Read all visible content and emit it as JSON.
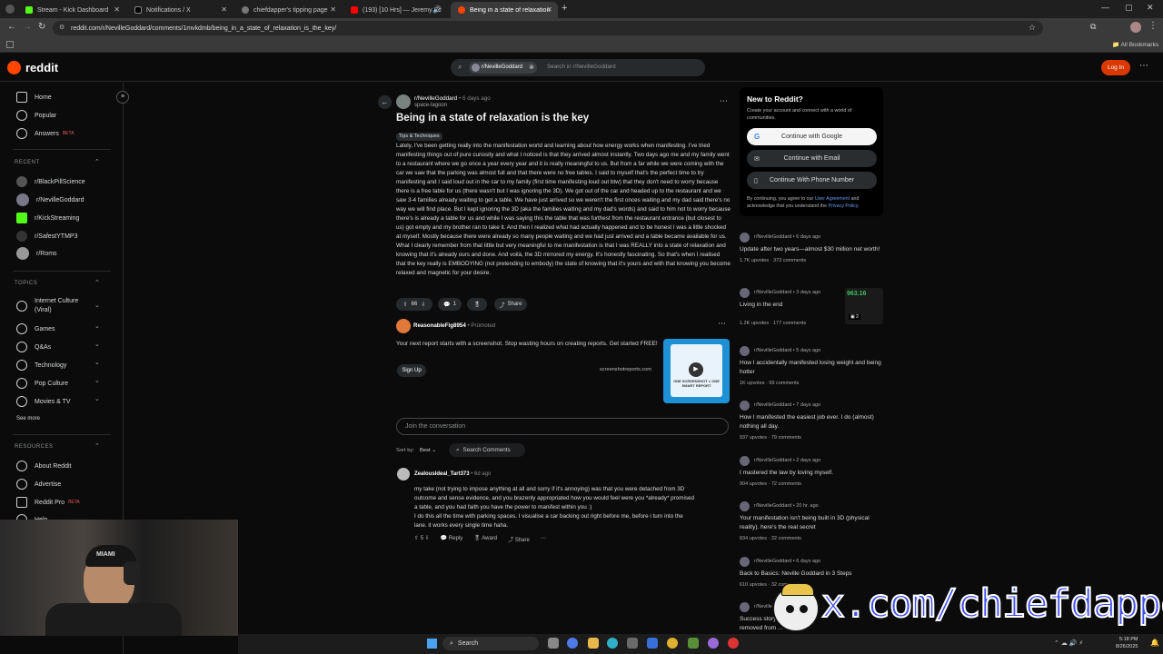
{
  "browser": {
    "tabs": [
      {
        "title": "Stream - Kick Dashboard",
        "fav": "#53fc18"
      },
      {
        "title": "Notifications / X",
        "fav": "#000000"
      },
      {
        "title": "chiefdapper's tipping page",
        "fav": "#777777"
      },
      {
        "title": "(193) [10 Hrs] — Jeremy Sc",
        "fav": "#ff0000"
      },
      {
        "title": "Being in a state of relaxation is",
        "fav": "#ff4500"
      }
    ],
    "url": "reddit.com/r/NevilleGoddard/comments/1mvkdmb/being_in_a_state_of_relaxation_is_the_key/",
    "all_bookmarks": "All Bookmarks"
  },
  "header": {
    "logo": "reddit",
    "search_chip": "r/NevilleGoddard",
    "search_placeholder": "Search in r/NevilleGoddard",
    "login": "Log In"
  },
  "sidebar": {
    "main": [
      "Home",
      "Popular",
      "Answers"
    ],
    "beta": "BETA",
    "recent_label": "RECENT",
    "recent": [
      "r/BlackPillScience",
      "r/NevilleGoddard",
      "r/KickStreaming",
      "r/SafestYTMP3",
      "r/Roms"
    ],
    "topics_label": "TOPICS",
    "topics": [
      "Internet Culture (Viral)",
      "Games",
      "Q&As",
      "Technology",
      "Pop Culture",
      "Movies & TV"
    ],
    "see_more": "See more",
    "resources_label": "RESOURCES",
    "resources": [
      "About Reddit",
      "Advertise",
      "Reddit Pro"
    ],
    "help": "Help"
  },
  "post": {
    "subreddit": "r/NevilleGoddard",
    "age": "6 days ago",
    "author": "space-lagoon",
    "title": "Being in a state of relaxation is the key",
    "flair": "Tips & Techniques",
    "body": "Lately, I've been getting really into the manifestation world and learning about how energy works when manifesting. I've tried manifesting things out of pure curiosity and what I noticed is that they arrived almost instantly. Two days ago me and my family went to a restaurant where we go once a year every year and it is really meaningful to us. But from a far while we were coming with the car we saw that the parking was almost full and that there were no free tables. I said to myself that's the perfect time to try manifesting and I said loud out in the car to my family (first time manifesting loud out btw) that they don't need to worry because there is a free table for us (there wasn't but I was ignoring the 3D). We got out of the car and headed up to the restaurant and we saw 3-4 families already waiting to get a table. We have just arrived so we weren't the first onces waiting and my dad said there's no way we will find place. But I kept ignoring the 3D (aka the families waiting and my dad's words) and said to him not to worry because there's is already a table for us and while I was saying this the table that was furthest from the restaurant entrance (but closest to us) got empty and my brother ran to take it. And then I realized what had actually happened and to be honest I was a little shocked at myself. Mostly because there were already so many people waiting and we had just arrived and a table became available for us. What I clearly remember from that little but very meaningful to me manifestation is that I was REALLY into a state of relaxation and knowing that it's already ours and done. And voilà, the 3D mirrored my energy. It's honestly fascinating. So that's when I realised that the key really is EMBODYING (not pretending to embody) the state of knowing that it's yours and with that knowing you become relaxed and magnetic for your desire.",
    "votes": "66",
    "comments": "1",
    "share": "Share"
  },
  "ad": {
    "user": "ReasonableFig8954",
    "promoted": "Promoted",
    "text": "Your next report starts with a screenshot. Stop wasting hours on creating reports. Get started FREE!",
    "cta": "Sign Up",
    "domain": "screenshotreports.com",
    "thumb_text": "ONE SCREENSHOT = ONE SMART REPORT"
  },
  "comment_box": {
    "placeholder": "Join the conversation",
    "sort_label": "Sort by:",
    "sort_value": "Best",
    "search": "Search Comments"
  },
  "comment": {
    "user": "ZealousIdeal_Tart373",
    "age": "6d ago",
    "lines": [
      "my take (not trying to impose anything at all and sorry if it's annoying) was that you were detached from 3D",
      "outcome and sense evidence, and you brazenly appropriated how you would feel were you *already* promised",
      "a table, and you had faith you have the power to manifest within you :)",
      "I do this all the time with parking spaces. I visualise a car backing out right before me, before i turn into the",
      "lane. it works every single time haha."
    ],
    "votes": "5",
    "reply": "Reply",
    "award": "Award",
    "share": "Share"
  },
  "signup": {
    "title": "New to Reddit?",
    "subtitle": "Create your account and connect with a world of communities.",
    "google": "Continue with Google",
    "email": "Continue with Email",
    "phone": "Continue With Phone Number",
    "legal_pre": "By continuing, you agree to our",
    "user_agreement": "User Agreement",
    "legal_mid": "and acknowledge that you understand the",
    "privacy": "Privacy Policy."
  },
  "related": [
    {
      "sub": "r/NevilleGoddard",
      "age": "6 days ago",
      "title": "Update after two years—almost $30 million net worth!",
      "meta": "1.7K upvotes · 373 comments"
    },
    {
      "sub": "r/NevilleGoddard",
      "age": "3 days ago",
      "title": "Living in the end",
      "meta": "1.2K upvotes · 177 comments",
      "thumb": "963.16",
      "thumb_count": "2"
    },
    {
      "sub": "r/NevilleGoddard",
      "age": "5 days ago",
      "title": "How I accidentally manifested losing weight and being hotter",
      "meta": "1K upvotes · 99 comments"
    },
    {
      "sub": "r/NevilleGoddard",
      "age": "7 days ago",
      "title": "How I manifested the easiest job ever. I do (almost) nothing all day.",
      "meta": "937 upvotes · 79 comments"
    },
    {
      "sub": "r/NevilleGoddard",
      "age": "2 days ago",
      "title": "I mastered the law by loving myself.",
      "meta": "904 upvotes · 72 comments"
    },
    {
      "sub": "r/NevilleGoddard",
      "age": "20 hr. ago",
      "title": "Your manifestation isn't being built in 3D (physical reality). here's the real secret",
      "meta": "834 upvotes · 32 comments"
    },
    {
      "sub": "r/NevilleGoddard",
      "age": "6 days ago",
      "title": "Back to Basics: Neville Goddard in 3 Steps",
      "meta": "610 upvotes · 32 comments"
    },
    {
      "sub": "r/Neville",
      "age": "",
      "title": "Success story ... removed from ...",
      "meta": ""
    }
  ],
  "overlay": {
    "watermark": "x.com/chiefdapper",
    "cap_text": "MIAMI"
  },
  "taskbar": {
    "search": "Search",
    "time": "5:18 PM",
    "date": "8/26/2025"
  }
}
